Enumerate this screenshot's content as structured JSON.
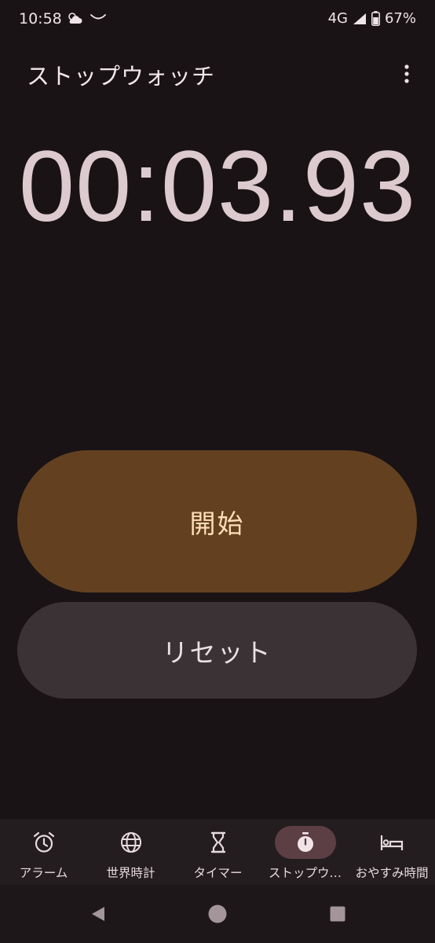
{
  "status_bar": {
    "time": "10:58",
    "network": "4G",
    "battery": "67%",
    "weather_icon": "partly-cloudy-icon",
    "battery_level": 0.67
  },
  "app_bar": {
    "title": "ストップウォッチ",
    "overflow_icon": "more-vert-icon"
  },
  "stopwatch": {
    "elapsed": "00:03.93"
  },
  "actions": {
    "start_label": "開始",
    "reset_label": "リセット"
  },
  "bottom_nav": {
    "items": [
      {
        "label": "アラーム",
        "icon": "alarm-icon",
        "active": false
      },
      {
        "label": "世界時計",
        "icon": "globe-icon",
        "active": false
      },
      {
        "label": "タイマー",
        "icon": "hourglass-icon",
        "active": false
      },
      {
        "label": "ストップウ…",
        "icon": "stopwatch-icon",
        "active": true
      },
      {
        "label": "おやすみ時間",
        "icon": "bed-icon",
        "active": false
      }
    ]
  },
  "colors": {
    "background": "#1a1315",
    "start_button": "#634120",
    "start_text": "#ffdfba",
    "reset_button": "#3b3235",
    "active_nav_pill": "#5c3f45",
    "timer_text": "#dccacf"
  }
}
